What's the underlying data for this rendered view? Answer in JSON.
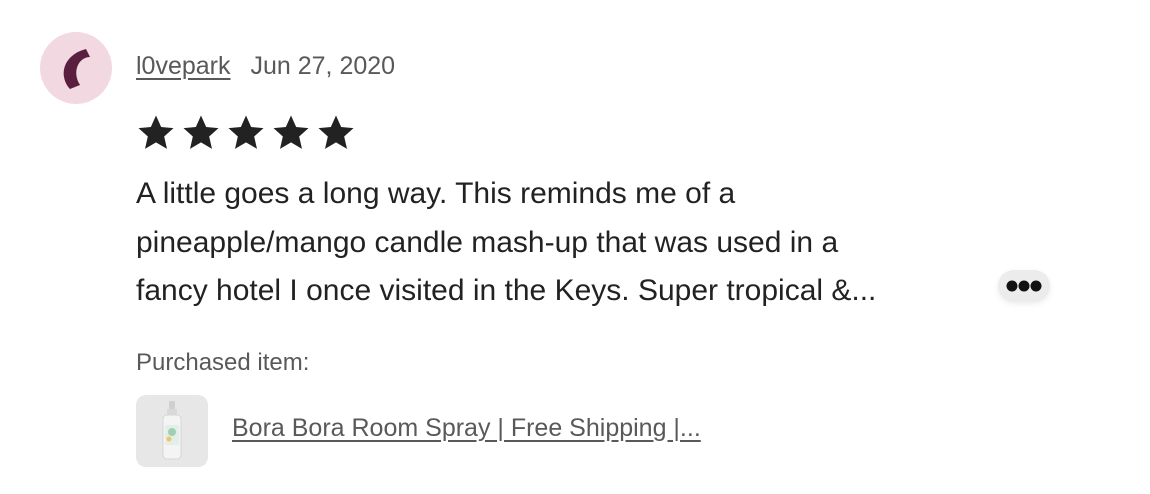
{
  "review": {
    "reviewer_name": "l0vepark",
    "date": "Jun 27, 2020",
    "rating": 5,
    "rating_max": 5,
    "text_lines": [
      "A little goes a long way. This reminds me of a",
      "pineapple/mango candle mash-up that was used in a",
      "fancy hotel I once visited in the Keys. Super tropical &..."
    ],
    "more_icon": "more-dots-icon"
  },
  "purchased": {
    "label": "Purchased item:",
    "item_title": "Bora Bora Room Spray | Free Shipping |..."
  },
  "colors": {
    "avatar_bg": "#f2d8e0",
    "avatar_mark": "#5a1f3e",
    "star": "#222222",
    "muted_text": "#595959"
  }
}
